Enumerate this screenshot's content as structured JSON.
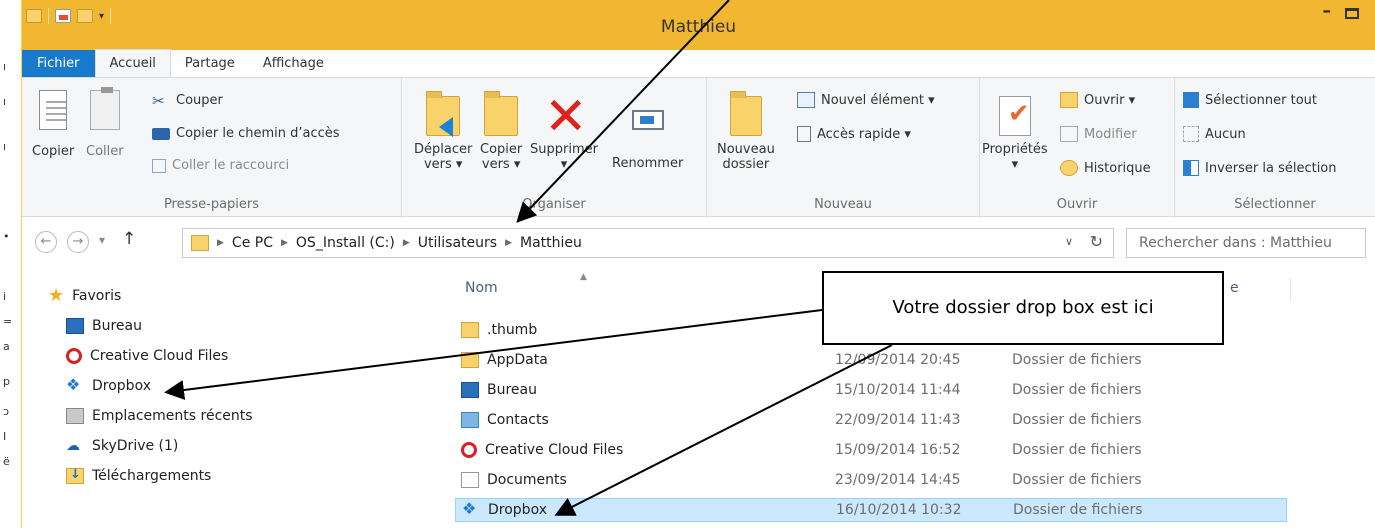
{
  "window": {
    "title": "Matthieu"
  },
  "tabs": [
    {
      "label": "Fichier"
    },
    {
      "label": "Accueil"
    },
    {
      "label": "Partage"
    },
    {
      "label": "Affichage"
    }
  ],
  "ribbon": {
    "clipboard": {
      "label": "Presse-papiers",
      "copy": "Copier",
      "paste": "Coller",
      "cut": "Couper",
      "copy_path": "Copier le chemin d’accès",
      "paste_shortcut": "Coller le raccourci"
    },
    "organize": {
      "label": "Organiser",
      "move_line1": "Déplacer",
      "move_line2": "vers ▾",
      "copy_line1": "Copier",
      "copy_line2": "vers ▾",
      "delete": "Supprimer",
      "rename": "Renommer"
    },
    "new": {
      "label": "Nouveau",
      "new_folder_line1": "Nouveau",
      "new_folder_line2": "dossier",
      "new_item": "Nouvel élément ▾",
      "easy_access": "Accès rapide ▾"
    },
    "open": {
      "label": "Ouvrir",
      "properties": "Propriétés",
      "open": "Ouvrir ▾",
      "edit": "Modifier",
      "history": "Historique"
    },
    "select": {
      "label": "Sélectionner",
      "select_all": "Sélectionner tout",
      "select_none": "Aucun",
      "invert": "Inverser la sélection"
    }
  },
  "address": {
    "crumbs": [
      "Ce PC",
      "OS_Install (C:)",
      "Utilisateurs",
      "Matthieu"
    ],
    "search_placeholder": "Rechercher dans : Matthieu"
  },
  "navpane": {
    "favorites": "Favoris",
    "items": [
      {
        "label": "Bureau",
        "icon": "desktop-icon"
      },
      {
        "label": "Creative Cloud Files",
        "icon": "creative-cloud-icon"
      },
      {
        "label": "Dropbox",
        "icon": "dropbox-icon"
      },
      {
        "label": "Emplacements récents",
        "icon": "recent-places-icon"
      },
      {
        "label": "SkyDrive (1)",
        "icon": "skydrive-icon"
      },
      {
        "label": "Téléchargements",
        "icon": "downloads-icon"
      }
    ]
  },
  "list": {
    "columns": {
      "name": "Nom",
      "type_partial": "e"
    },
    "rows": [
      {
        "name": ".thumb",
        "date": "",
        "type": "",
        "icon": "folder-icon"
      },
      {
        "name": "AppData",
        "date": "12/09/2014 20:45",
        "type": "Dossier de fichiers",
        "icon": "folder-icon"
      },
      {
        "name": "Bureau",
        "date": "15/10/2014 11:44",
        "type": "Dossier de fichiers",
        "icon": "desktop-folder-icon"
      },
      {
        "name": "Contacts",
        "date": "22/09/2014 11:43",
        "type": "Dossier de fichiers",
        "icon": "contacts-icon"
      },
      {
        "name": "Creative Cloud Files",
        "date": "15/09/2014 16:52",
        "type": "Dossier de fichiers",
        "icon": "creative-cloud-icon"
      },
      {
        "name": "Documents",
        "date": "23/09/2014 14:45",
        "type": "Dossier de fichiers",
        "icon": "documents-icon"
      },
      {
        "name": "Dropbox",
        "date": "16/10/2014 10:32",
        "type": "Dossier de fichiers",
        "icon": "dropbox-icon",
        "selected": true
      }
    ]
  },
  "callout": {
    "text": "Votre dossier drop box est ici"
  },
  "colors": {
    "titlebar": "#f2b731",
    "file_tab": "#1979ca",
    "selection": "#cce8ff"
  }
}
